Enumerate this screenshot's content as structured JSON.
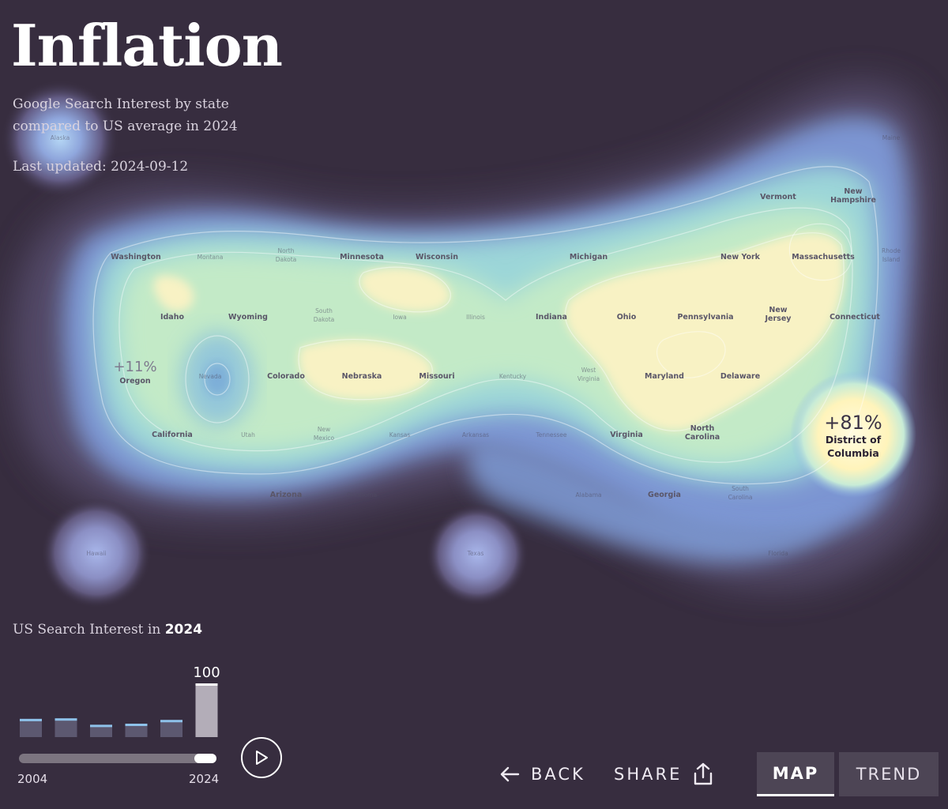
{
  "header": {
    "title": "Inflation",
    "subtitle": "Google Search Interest by state compared to US average in 2024",
    "last_updated": "Last updated: 2024-09-12"
  },
  "map": {
    "states": [
      {
        "name": "Alaska",
        "emphasis": "faint"
      },
      {
        "name": "Maine",
        "emphasis": "faint"
      },
      {
        "name": "Vermont",
        "emphasis": "normal"
      },
      {
        "name": "New Hampshire",
        "emphasis": "normal"
      },
      {
        "name": "Washington",
        "emphasis": "normal"
      },
      {
        "name": "Montana",
        "emphasis": "faint"
      },
      {
        "name": "North Dakota",
        "emphasis": "faint"
      },
      {
        "name": "Minnesota",
        "emphasis": "normal"
      },
      {
        "name": "Wisconsin",
        "emphasis": "normal"
      },
      {
        "name": "Michigan",
        "emphasis": "normal"
      },
      {
        "name": "New York",
        "emphasis": "normal"
      },
      {
        "name": "Massachusetts",
        "emphasis": "normal"
      },
      {
        "name": "Rhode Island",
        "emphasis": "faint"
      },
      {
        "name": "Idaho",
        "emphasis": "normal"
      },
      {
        "name": "Wyoming",
        "emphasis": "normal"
      },
      {
        "name": "South Dakota",
        "emphasis": "faint"
      },
      {
        "name": "Iowa",
        "emphasis": "faint"
      },
      {
        "name": "Illinois",
        "emphasis": "faint"
      },
      {
        "name": "Indiana",
        "emphasis": "normal"
      },
      {
        "name": "Ohio",
        "emphasis": "normal"
      },
      {
        "name": "Pennsylvania",
        "emphasis": "normal"
      },
      {
        "name": "New Jersey",
        "emphasis": "normal"
      },
      {
        "name": "Connecticut",
        "emphasis": "normal"
      },
      {
        "name": "Oregon",
        "emphasis": "highlight",
        "value": "+11%"
      },
      {
        "name": "Nevada",
        "emphasis": "faint"
      },
      {
        "name": "Colorado",
        "emphasis": "normal"
      },
      {
        "name": "Nebraska",
        "emphasis": "normal"
      },
      {
        "name": "Missouri",
        "emphasis": "normal"
      },
      {
        "name": "Kentucky",
        "emphasis": "faint"
      },
      {
        "name": "West Virginia",
        "emphasis": "faint"
      },
      {
        "name": "Maryland",
        "emphasis": "normal"
      },
      {
        "name": "Delaware",
        "emphasis": "normal"
      },
      {
        "name": "District of Columbia",
        "emphasis": "highlight",
        "value": "+81%"
      },
      {
        "name": "California",
        "emphasis": "normal"
      },
      {
        "name": "Utah",
        "emphasis": "faint"
      },
      {
        "name": "New Mexico",
        "emphasis": "faint"
      },
      {
        "name": "Kansas",
        "emphasis": "faint"
      },
      {
        "name": "Arkansas",
        "emphasis": "faint"
      },
      {
        "name": "Tennessee",
        "emphasis": "faint"
      },
      {
        "name": "Virginia",
        "emphasis": "normal"
      },
      {
        "name": "North Carolina",
        "emphasis": "normal"
      },
      {
        "name": "Arizona",
        "emphasis": "normal"
      },
      {
        "name": "Oklahoma",
        "emphasis": "faint"
      },
      {
        "name": "Alabama",
        "emphasis": "faint"
      },
      {
        "name": "Georgia",
        "emphasis": "normal"
      },
      {
        "name": "South Carolina",
        "emphasis": "faint"
      },
      {
        "name": "Hawaii",
        "emphasis": "faint"
      },
      {
        "name": "Texas",
        "emphasis": "faint"
      },
      {
        "name": "Florida",
        "emphasis": "faint"
      }
    ],
    "colors": {
      "background": "#372d3f",
      "low": "#5b5575",
      "mid_blue": "#7fa9dc",
      "mid_green": "#a8e2cc",
      "high": "#fff7cc"
    }
  },
  "timeline": {
    "label_prefix": "US Search Interest in",
    "selected_year": "2024",
    "selected_value": "100",
    "start_label": "2004",
    "end_label": "2024",
    "position": 1.0,
    "bars": [
      {
        "value": 34,
        "selected": false
      },
      {
        "value": 35,
        "selected": false
      },
      {
        "value": 23,
        "selected": false
      },
      {
        "value": 25,
        "selected": false
      },
      {
        "value": 32,
        "selected": false
      },
      {
        "value": 100,
        "selected": true
      }
    ],
    "colors": {
      "bar": "#5c5870",
      "bar_cap": "#8ec2ea",
      "bar_selected": "#b3adb8"
    }
  },
  "controls": {
    "play_icon": "play-icon",
    "back_label": "BACK",
    "back_icon": "arrow-left-icon",
    "share_label": "SHARE",
    "share_icon": "share-icon"
  },
  "tabs": [
    {
      "label": "MAP",
      "active": true
    },
    {
      "label": "TREND",
      "active": false
    }
  ]
}
